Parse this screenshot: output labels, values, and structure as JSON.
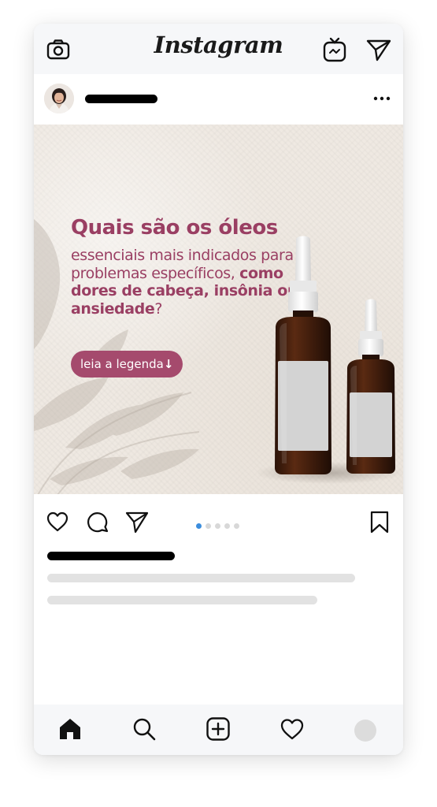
{
  "app": {
    "title": "Instagram"
  },
  "top_bar": {
    "icons": [
      "camera-icon",
      "igtv-icon",
      "direct-message-icon"
    ]
  },
  "post": {
    "header": {
      "username": "",
      "more_icon": "more-options-icon"
    },
    "slide": {
      "headline": "Quais são os óleos",
      "body_regular_1": "essenciais mais indicados para problemas específicos, ",
      "body_bold": "como dores de cabeça, insônia ou ansiedade",
      "body_regular_2": "?",
      "cta_label": "leia a legenda",
      "cta_arrow": "↓",
      "colors": {
        "text": "#9a3f63",
        "cta_background": "#a54a6d",
        "background": "#efe9e2"
      }
    },
    "carousel": {
      "total_slides": 5,
      "current_slide": 1,
      "active_color": "#3b8ddd"
    },
    "actions": {
      "icons": [
        "like-icon",
        "comment-icon",
        "share-icon",
        "save-icon"
      ]
    }
  },
  "bottom_nav": {
    "items": [
      "home-icon",
      "search-icon",
      "new-post-icon",
      "activity-icon",
      "profile-avatar"
    ],
    "active": "home-icon"
  }
}
